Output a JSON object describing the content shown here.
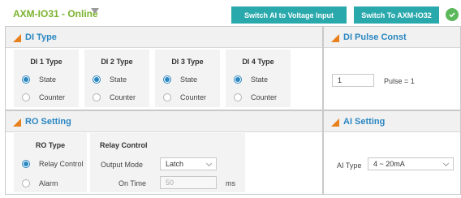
{
  "header": {
    "device_title": "AXM-IO31 - Online",
    "switch_ai_label": "Switch AI to Voltage Input",
    "switch_device_label": "Switch To AXM-IO32"
  },
  "di_type": {
    "title": "DI Type",
    "cards": [
      {
        "title": "DI 1 Type",
        "options": [
          "State",
          "Counter"
        ],
        "selected": "State"
      },
      {
        "title": "DI 2 Type",
        "options": [
          "State",
          "Counter"
        ],
        "selected": "State"
      },
      {
        "title": "DI 3 Type",
        "options": [
          "State",
          "Counter"
        ],
        "selected": "State"
      },
      {
        "title": "DI 4 Type",
        "options": [
          "State",
          "Counter"
        ],
        "selected": "State"
      }
    ]
  },
  "di_pulse": {
    "title": "DI Pulse Const",
    "value": "1",
    "hint": "Pulse = 1"
  },
  "ro_setting": {
    "title": "RO Setting",
    "ro_type": {
      "title": "RO Type",
      "options": [
        "Relay Control",
        "Alarm"
      ],
      "selected": "Relay Control"
    },
    "relay": {
      "title": "Relay Control",
      "output_mode_label": "Output Mode",
      "output_mode_value": "Latch",
      "on_time_label": "On Time",
      "on_time_value": "50",
      "on_time_unit": "ms"
    }
  },
  "ai_setting": {
    "title": "AI Setting",
    "ai_type_label": "AI Type",
    "ai_type_value": "4 ~ 20mA"
  },
  "colors": {
    "accent_green": "#7ab32e",
    "button_teal": "#2aa9ad",
    "title_blue": "#2a87c2",
    "triangle_orange": "#e8801e",
    "status_green": "#5cb85c"
  }
}
